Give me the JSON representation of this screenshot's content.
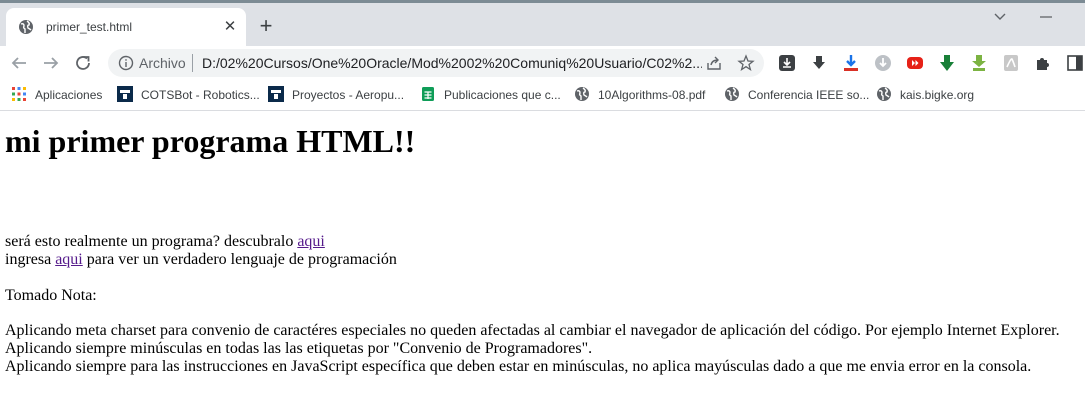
{
  "browser": {
    "tab": {
      "title": "primer_test.html",
      "icon": "globe-icon"
    },
    "address": {
      "scheme_label": "Archivo",
      "url": "D:/02%20Cursos/One%20Oracle/Mod%2002%20Comuniq%20Usuario/C02%2..."
    },
    "bookmarks": [
      {
        "label": "Aplicaciones",
        "icon": "apps-grid-icon"
      },
      {
        "label": "COTSBot - Robotics...",
        "icon": "qut-icon"
      },
      {
        "label": "Proyectos - Aeropu...",
        "icon": "qut-icon"
      },
      {
        "label": "Publicaciones que c...",
        "icon": "sheets-icon"
      },
      {
        "label": "10Algorithms-08.pdf",
        "icon": "globe-icon"
      },
      {
        "label": "Conferencia IEEE so...",
        "icon": "globe-icon"
      },
      {
        "label": "kais.bigke.org",
        "icon": "globe-icon"
      }
    ],
    "colors": {
      "tabstrip": "#dee1e6",
      "omnibox": "#f1f3f4",
      "link": "#551a8b"
    }
  },
  "page": {
    "heading": "mi primer programa HTML!!",
    "line1_text": "será esto realmente un programa? descubralo ",
    "line1_link": "aqui",
    "line2_prefix": "ingresa ",
    "line2_link": "aqui",
    "line2_suffix": " para ver un verdadero lenguaje de programación",
    "notes_title": "Tomado Nota:",
    "notes": [
      "Aplicando meta charset para convenio de caractéres especiales no queden afectadas al cambiar el navegador de aplicación del código. Por ejemplo Internet Explorer.",
      "Aplicando siempre minúsculas en todas las las etiquetas por \"Convenio de Programadores\".",
      "Aplicando siempre para las instrucciones en JavaScript específica que deben estar en minúsculas, no aplica mayúsculas dado a que me envia error en la consola."
    ]
  }
}
